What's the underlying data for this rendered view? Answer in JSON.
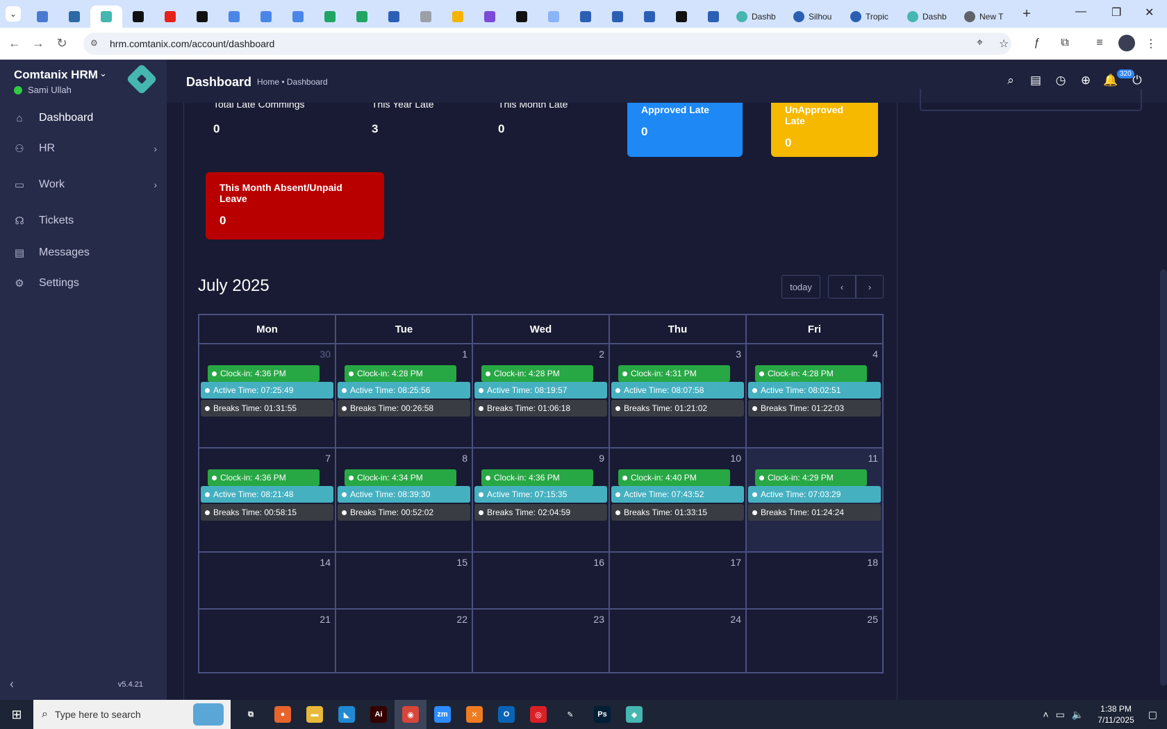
{
  "browser": {
    "tabs": [
      {
        "icon": "expand-tabs-icon"
      },
      {
        "icon": "favicon-blue-circle"
      },
      {
        "icon": "favicon-vpn"
      },
      {
        "icon": "favicon-comtanix",
        "active": true
      },
      {
        "icon": "favicon-openai"
      },
      {
        "icon": "favicon-youtube"
      },
      {
        "icon": "favicon-bolt"
      },
      {
        "icon": "favicon-docs"
      },
      {
        "icon": "favicon-docs"
      },
      {
        "icon": "favicon-docs"
      },
      {
        "icon": "favicon-sheets"
      },
      {
        "icon": "favicon-sheets"
      },
      {
        "icon": "favicon-word"
      },
      {
        "icon": "favicon-box"
      },
      {
        "icon": "favicon-vue"
      },
      {
        "icon": "favicon-brackets"
      },
      {
        "icon": "favicon-angular"
      },
      {
        "icon": "favicon-grid"
      },
      {
        "icon": "favicon-forms"
      },
      {
        "icon": "favicon-forms"
      },
      {
        "icon": "favicon-forms"
      },
      {
        "icon": "favicon-medium"
      },
      {
        "icon": "favicon-forms"
      }
    ],
    "named_tabs": [
      {
        "title": "Dashb",
        "icon": "favicon-comtanix"
      },
      {
        "title": "Silhou",
        "icon": "favicon-forms"
      },
      {
        "title": "Tropic",
        "icon": "favicon-forms"
      },
      {
        "title": "Dashb",
        "icon": "favicon-comtanix"
      },
      {
        "title": "New T",
        "icon": "chrome-icon"
      }
    ],
    "url": "hrm.comtanix.com/account/dashboard"
  },
  "sidebar": {
    "brand": "Comtanix HRM",
    "user": "Sami Ullah",
    "items": [
      {
        "label": "Dashboard",
        "icon": "home-icon",
        "active": true
      },
      {
        "label": "HR",
        "icon": "users-icon",
        "arrow": true
      },
      {
        "label": "Work",
        "icon": "briefcase-icon",
        "arrow": true
      },
      {
        "label": "Tickets",
        "icon": "headset-icon"
      },
      {
        "label": "Messages",
        "icon": "chat-icon"
      },
      {
        "label": "Settings",
        "icon": "gear-icon"
      }
    ],
    "version": "v5.4.21"
  },
  "header": {
    "title": "Dashboard",
    "breadcrumb": "Home • Dashboard",
    "notifications": "320"
  },
  "stats": {
    "total_late": {
      "label": "Total Late Commings",
      "value": "0"
    },
    "year_late": {
      "label": "This Year Late",
      "value": "3"
    },
    "month_late": {
      "label": "This Month Late",
      "value": "0"
    },
    "approved": {
      "label": "Approved Late",
      "value": "0",
      "color": "#1e88f5"
    },
    "unapproved": {
      "label": "UnApproved Late",
      "value": "0",
      "color": "#f6b900"
    },
    "absent": {
      "label": "This Month Absent/Unpaid Leave",
      "value": "0",
      "color": "#b90000"
    }
  },
  "calendar": {
    "title": "July 2025",
    "today_label": "today",
    "days": [
      "Mon",
      "Tue",
      "Wed",
      "Thu",
      "Fri"
    ],
    "weeks": [
      [
        {
          "day": "30",
          "muted": true,
          "clock": "Clock-in: 4:36 PM",
          "active": "Active Time: 07:25:49",
          "breaks": "Breaks Time: 01:31:55"
        },
        {
          "day": "1",
          "clock": "Clock-in: 4:28 PM",
          "active": "Active Time: 08:25:56",
          "breaks": "Breaks Time: 00:26:58"
        },
        {
          "day": "2",
          "clock": "Clock-in: 4:28 PM",
          "active": "Active Time: 08:19:57",
          "breaks": "Breaks Time: 01:06:18"
        },
        {
          "day": "3",
          "clock": "Clock-in: 4:31 PM",
          "active": "Active Time: 08:07:58",
          "breaks": "Breaks Time: 01:21:02"
        },
        {
          "day": "4",
          "clock": "Clock-in: 4:28 PM",
          "active": "Active Time: 08:02:51",
          "breaks": "Breaks Time: 01:22:03"
        }
      ],
      [
        {
          "day": "7",
          "clock": "Clock-in: 4:36 PM",
          "active": "Active Time: 08:21:48",
          "breaks": "Breaks Time: 00:58:15"
        },
        {
          "day": "8",
          "clock": "Clock-in: 4:34 PM",
          "active": "Active Time: 08:39:30",
          "breaks": "Breaks Time: 00:52:02"
        },
        {
          "day": "9",
          "clock": "Clock-in: 4:36 PM",
          "active": "Active Time: 07:15:35",
          "breaks": "Breaks Time: 02:04:59"
        },
        {
          "day": "10",
          "clock": "Clock-in: 4:40 PM",
          "active": "Active Time: 07:43:52",
          "breaks": "Breaks Time: 01:33:15"
        },
        {
          "day": "11",
          "today": true,
          "clock": "Clock-in: 4:29 PM",
          "active": "Active Time: 07:03:29",
          "breaks": "Breaks Time: 01:24:24"
        }
      ],
      [
        {
          "day": "14"
        },
        {
          "day": "15"
        },
        {
          "day": "16"
        },
        {
          "day": "17"
        },
        {
          "day": "18"
        }
      ],
      [
        {
          "day": "21"
        },
        {
          "day": "22"
        },
        {
          "day": "23"
        },
        {
          "day": "24"
        },
        {
          "day": "25"
        }
      ]
    ]
  },
  "taskbar": {
    "search_placeholder": "Type here to search",
    "apps": [
      {
        "name": "task-view",
        "label": "⧉",
        "color": "#1c2435"
      },
      {
        "name": "firefox",
        "label": "●",
        "color": "#e8642c"
      },
      {
        "name": "file-explorer",
        "label": "▬",
        "color": "#e9b93a"
      },
      {
        "name": "vscode",
        "label": "◣",
        "color": "#1f8ad2"
      },
      {
        "name": "illustrator",
        "label": "Ai",
        "color": "#330000"
      },
      {
        "name": "chrome",
        "label": "◉",
        "color": "#d8453a",
        "active": true
      },
      {
        "name": "zoom",
        "label": "zm",
        "color": "#2d8cff"
      },
      {
        "name": "xampp",
        "label": "✕",
        "color": "#f07c21"
      },
      {
        "name": "outlook",
        "label": "O",
        "color": "#0a64b6"
      },
      {
        "name": "creative-cloud",
        "label": "◎",
        "color": "#da1f26"
      },
      {
        "name": "pen-tool",
        "label": "✎",
        "color": "#1c2435"
      },
      {
        "name": "photoshop",
        "label": "Ps",
        "color": "#001e36"
      },
      {
        "name": "comtanix-app",
        "label": "◆",
        "color": "#45b6b0"
      }
    ],
    "time": "1:38 PM",
    "date": "7/11/2025"
  }
}
